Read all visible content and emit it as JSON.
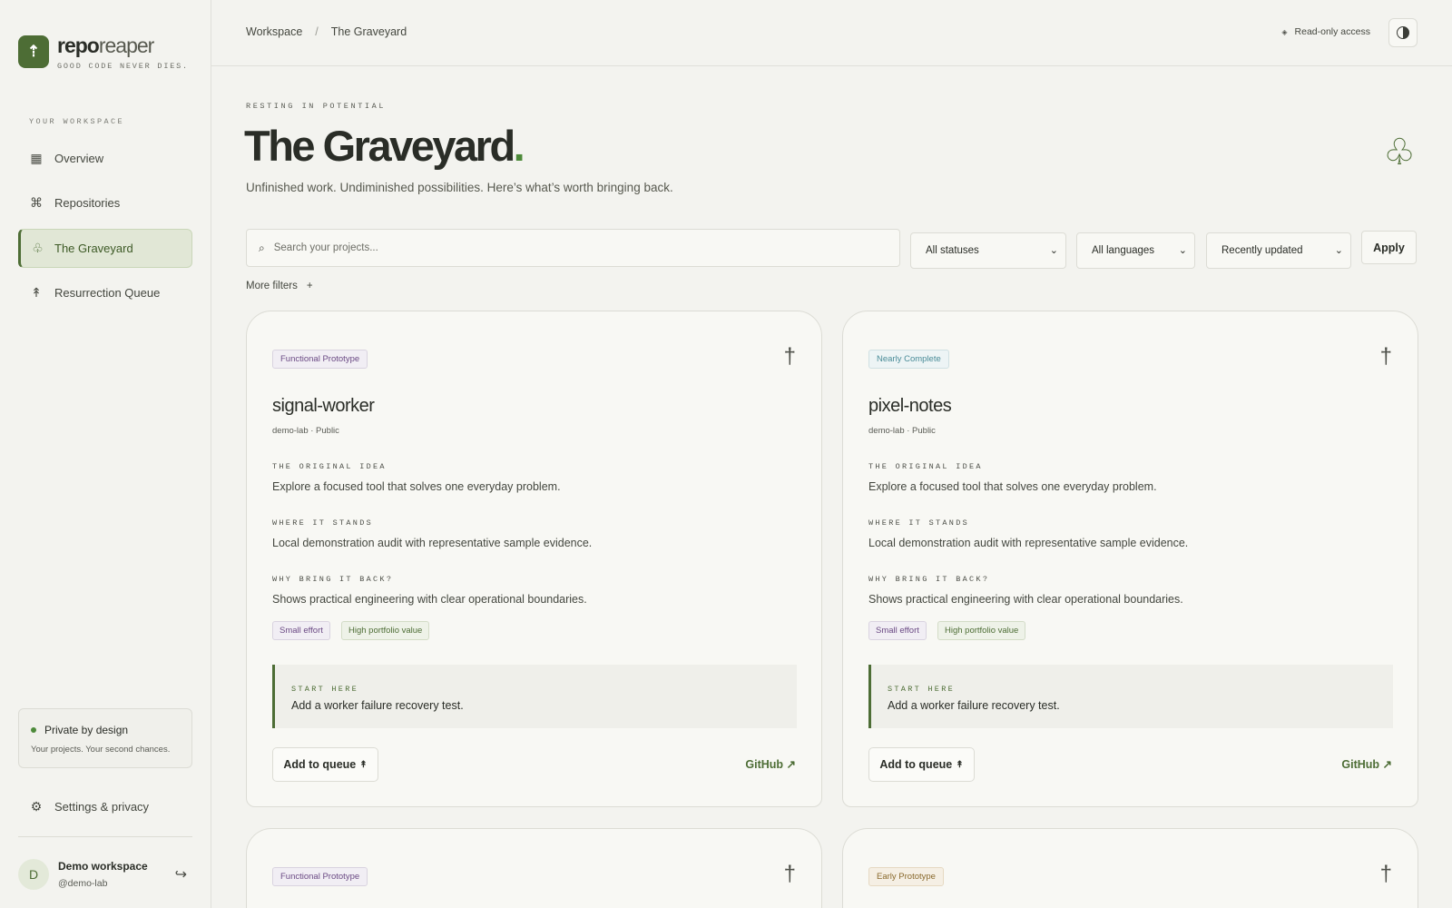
{
  "brand": {
    "name_strong": "repo",
    "name_light": "reaper",
    "tagline": "GOOD CODE NEVER DIES.",
    "logo_icon": "arrow-up-icon"
  },
  "sidebar": {
    "section_label": "YOUR WORKSPACE",
    "items": [
      {
        "label": "Overview",
        "icon": "grid-icon",
        "glyph": "▦",
        "active": false
      },
      {
        "label": "Repositories",
        "icon": "command-icon",
        "glyph": "⌘",
        "active": false
      },
      {
        "label": "The Graveyard",
        "icon": "clover-icon",
        "glyph": "♧",
        "active": true
      },
      {
        "label": "Resurrection Queue",
        "icon": "arrow-up-icon",
        "glyph": "↟",
        "active": false
      }
    ],
    "private": {
      "title": "Private by design",
      "subtitle": "Your projects. Your second chances."
    },
    "settings_label": "Settings & privacy",
    "account": {
      "initial": "D",
      "name": "Demo workspace",
      "handle": "@demo-lab"
    }
  },
  "header": {
    "breadcrumbs": [
      "Workspace",
      "The Graveyard"
    ],
    "access_label": "Read-only access"
  },
  "page": {
    "eyebrow": "RESTING IN POTENTIAL",
    "title": "The Graveyard",
    "title_period": ".",
    "subtitle": "Unfinished work. Undiminished possibilities. Here’s what’s worth bringing back."
  },
  "filters": {
    "search_placeholder": "Search your projects...",
    "status": "All statuses",
    "language": "All languages",
    "sort": "Recently updated",
    "apply_label": "Apply",
    "more_label": "More filters",
    "more_symbol": "+"
  },
  "card_labels": {
    "idea": "THE ORIGINAL IDEA",
    "stands": "WHERE IT STANDS",
    "why": "WHY BRING IT BACK?",
    "start": "START HERE",
    "queue_button": "Add to queue",
    "queue_arrow": "↟",
    "github_link": "GitHub ↗"
  },
  "projects": [
    {
      "status": "Functional Prototype",
      "name": "signal-worker",
      "meta": "demo-lab · Public",
      "idea": "Explore a focused tool that solves one everyday problem.",
      "stands": "Local demonstration audit with representative sample evidence.",
      "why": "Shows practical engineering with clear operational boundaries.",
      "effort": "Small effort",
      "value": "High portfolio value",
      "start": "Add a worker failure recovery test."
    },
    {
      "status": "Nearly Complete",
      "name": "pixel-notes",
      "meta": "demo-lab · Public",
      "idea": "Explore a focused tool that solves one everyday problem.",
      "stands": "Local demonstration audit with representative sample evidence.",
      "why": "Shows practical engineering with clear operational boundaries.",
      "effort": "Small effort",
      "value": "High portfolio value",
      "start": "Add a worker failure recovery test."
    },
    {
      "status": "Functional Prototype"
    },
    {
      "status": "Early Prototype"
    }
  ],
  "colors": {
    "accent": "#4d6d35",
    "background": "#f3f3ef",
    "card": "#f8f8f4"
  }
}
